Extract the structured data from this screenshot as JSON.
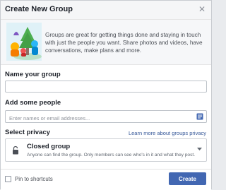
{
  "dialog": {
    "title": "Create New Group",
    "close_icon": "close-icon"
  },
  "intro": {
    "illustration": "group-illustration",
    "description": "Groups are great for getting things done and staying in touch with just the people you want. Share photos and videos, have conversations, make plans and more."
  },
  "form": {
    "name_label": "Name your group",
    "name_value": "",
    "people_label": "Add some people",
    "people_placeholder": "Enter names or email addresses...",
    "people_icon": "contacts-book-icon",
    "privacy_label": "Select privacy",
    "privacy_link": "Learn more about groups privacy",
    "privacy_selected": {
      "icon": "lock-icon",
      "title": "Closed group",
      "description": "Anyone can find the group. Only members can see who's in it and what they post."
    }
  },
  "footer": {
    "pin_label": "Pin to shortcuts",
    "pin_checked": false,
    "create_label": "Create"
  },
  "colors": {
    "accent": "#4267b2",
    "link": "#365899"
  }
}
